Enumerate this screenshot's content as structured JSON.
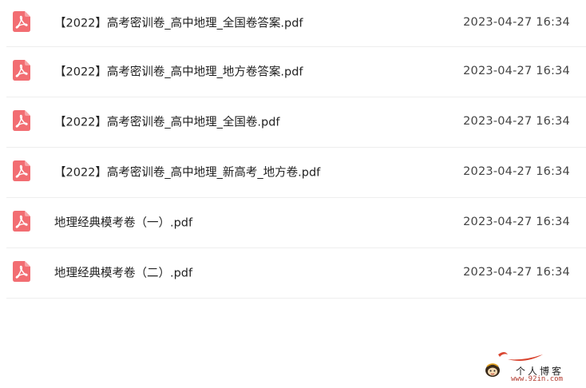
{
  "colors": {
    "pdf_icon": "#f26d72",
    "divider": "#eeeeee",
    "watermark_accent": "#d9442f"
  },
  "files": [
    {
      "icon": "pdf-icon",
      "name": "【2022】高考密训卷_高中地理_全国卷答案.pdf",
      "date": "2023-04-27 16:34"
    },
    {
      "icon": "pdf-icon",
      "name": "【2022】高考密训卷_高中地理_地方卷答案.pdf",
      "date": "2023-04-27 16:34"
    },
    {
      "icon": "pdf-icon",
      "name": "【2022】高考密训卷_高中地理_全国卷.pdf",
      "date": "2023-04-27 16:34"
    },
    {
      "icon": "pdf-icon",
      "name": "【2022】高考密训卷_高中地理_新高考_地方卷.pdf",
      "date": "2023-04-27 16:34"
    },
    {
      "icon": "pdf-icon",
      "name": "地理经典模考卷（一）.pdf",
      "date": "2023-04-27 16:34"
    },
    {
      "icon": "pdf-icon",
      "name": "地理经典模考卷（二）.pdf",
      "date": "2023-04-27 16:34"
    }
  ],
  "watermark": {
    "title": "个人博客",
    "url": "www.92in.com"
  }
}
